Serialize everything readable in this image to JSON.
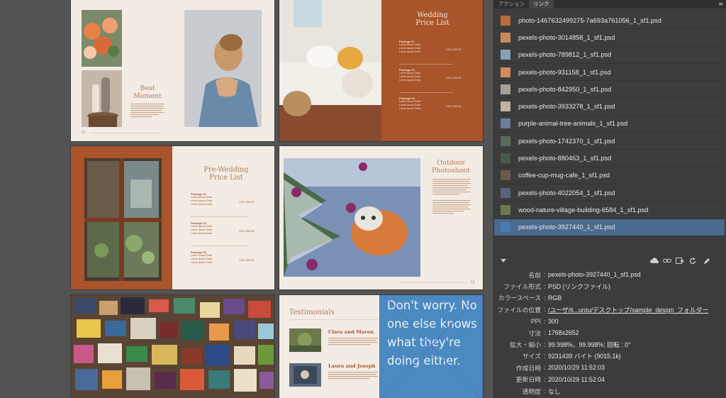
{
  "panel": {
    "tabs": [
      {
        "label": "アクション"
      },
      {
        "label": "リンク"
      }
    ],
    "links": [
      {
        "name": "photo-1467632499275-7a693a761056_1_sf1.psd",
        "thumb": "#b96a3c"
      },
      {
        "name": "pexels-photo-3014858_1_sf1.psd",
        "thumb": "#c98a5a"
      },
      {
        "name": "pexels-photo-789812_1_sf1.psd",
        "thumb": "#8aa0b8"
      },
      {
        "name": "pexels-photo-931158_1_sf1.psd",
        "thumb": "#d4895a"
      },
      {
        "name": "pexels-photo-842950_1_sf1.psd",
        "thumb": "#a8a098"
      },
      {
        "name": "pexels-photo-3933278_1_sf1.psd",
        "thumb": "#c2b2a4"
      },
      {
        "name": "purple-animal-tree-animals_1_sf1.psd",
        "thumb": "#6a7c9a"
      },
      {
        "name": "pexels-photo-1742370_1_sf1.psd",
        "thumb": "#5a6a5a"
      },
      {
        "name": "pexels-photo-880463_1_sf1.psd",
        "thumb": "#4a5a4a"
      },
      {
        "name": "coffee-cup-mug-cafe_1_sf1.psd",
        "thumb": "#6a5a4a"
      },
      {
        "name": "pexels-photo-4022054_1_sf1.psd",
        "thumb": "#5a6080"
      },
      {
        "name": "wood-nature-village-building-6584_1_sf1.psd",
        "thumb": "#6a7a50"
      },
      {
        "name": "pexels-photo-3927440_1_sf1.psd",
        "thumb": "#4a7ab0"
      }
    ],
    "info": [
      {
        "label": "名前",
        "value": "pexels-photo-3927440_1_sf1.psd"
      },
      {
        "label": "ファイル形式",
        "value": "PSD (リンクファイル)"
      },
      {
        "label": "カラースペース",
        "value": "RGB"
      },
      {
        "label": "ファイルの位置",
        "value": "/ユーザ/it...urou/デスクトップ/sample_design_フォルダー"
      },
      {
        "label": "PPI",
        "value": "300"
      },
      {
        "label": "寸法",
        "value": "1768x2652"
      },
      {
        "label": "拡大・縮小",
        "value": "99.998%、99.998%; 回転 : 0°"
      },
      {
        "label": "サイズ",
        "value": "9231439 バイト (9015.1k)"
      },
      {
        "label": "作成日時",
        "value": "2020/10/29 11:52:03"
      },
      {
        "label": "更新日時",
        "value": "2020/10/29 11:52:04"
      },
      {
        "label": "透明度",
        "value": "なし"
      }
    ],
    "toolbar_icons": [
      "cloud-icon",
      "link-icon",
      "relink-icon",
      "refresh-icon",
      "edit-icon"
    ],
    "menu_icon": "≡"
  },
  "pages": {
    "best_moment": {
      "title_1": "Best",
      "title_2": "Moment",
      "page_number": "01"
    },
    "wedding": {
      "title_1": "Wedding",
      "title_2": "Price List",
      "packages": [
        {
          "name": "Package 01",
          "price": "USD 1000.00"
        },
        {
          "name": "Package 02",
          "price": "USD 1000.00"
        },
        {
          "name": "Package 03",
          "price": "USD 1000.00"
        }
      ],
      "line_text": "Lorem Ipsum Dolor"
    },
    "prewedding": {
      "title_1": "Pre-Wedding",
      "title_2": "Price List",
      "packages": [
        {
          "name": "Package 01",
          "price": "USD 1000.00"
        },
        {
          "name": "Package 02",
          "price": "USD 1000.00"
        },
        {
          "name": "Package 03",
          "price": "USD 1000.00"
        }
      ],
      "line_text": "Lorem Ipsum Dolor"
    },
    "outdoor": {
      "title_1": "Outdoor",
      "title_2": "Photoshoot",
      "page_number": "12"
    },
    "testimonials": {
      "title": "Testimonials",
      "people": [
        {
          "name": "Clara and Maren"
        },
        {
          "name": "Laura and Joseph"
        }
      ]
    },
    "quote": {
      "text": "Don't worry. No one else knows what they're doing either."
    }
  },
  "colors": {
    "rust": "#a9542a",
    "cream": "#f3ece4",
    "heading": "#b67a55",
    "selection": "#4a6a8f",
    "panel_bg": "#3c3c3c"
  }
}
